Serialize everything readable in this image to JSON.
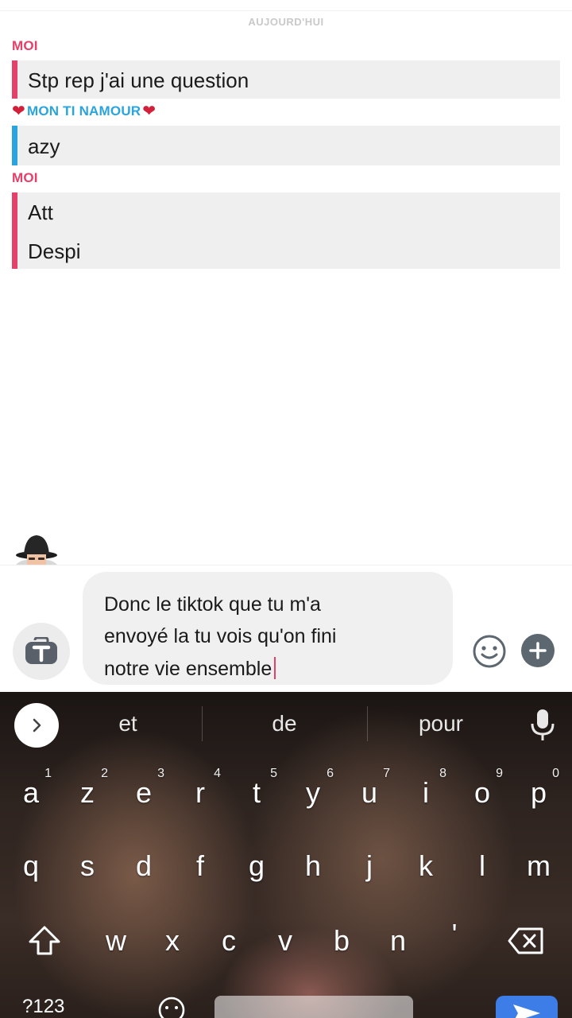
{
  "chat": {
    "date_label": "AUJOURD'HUI",
    "messages": [
      {
        "sender": "MOI",
        "side": "me",
        "lines": [
          "Stp rep j'ai une question"
        ]
      },
      {
        "sender": "MON TI NAMOUR",
        "side": "them",
        "lines": [
          "azy"
        ]
      },
      {
        "sender": "MOI",
        "side": "me",
        "lines": [
          "Att",
          "Despi"
        ]
      }
    ],
    "heart_glyph": "❤"
  },
  "composer": {
    "draft_lines": [
      "Donc le tiktok que tu m'a",
      "envoyé la tu vois qu'on fini",
      "notre vie ensemble"
    ]
  },
  "keyboard": {
    "suggestions": [
      "et",
      "de",
      "pour"
    ],
    "row1": [
      {
        "k": "a",
        "n": "1"
      },
      {
        "k": "z",
        "n": "2"
      },
      {
        "k": "e",
        "n": "3"
      },
      {
        "k": "r",
        "n": "4"
      },
      {
        "k": "t",
        "n": "5"
      },
      {
        "k": "y",
        "n": "6"
      },
      {
        "k": "u",
        "n": "7"
      },
      {
        "k": "i",
        "n": "8"
      },
      {
        "k": "o",
        "n": "9"
      },
      {
        "k": "p",
        "n": "0"
      }
    ],
    "row2": [
      "q",
      "s",
      "d",
      "f",
      "g",
      "h",
      "j",
      "k",
      "l",
      "m"
    ],
    "row3": [
      "w",
      "x",
      "c",
      "v",
      "b",
      "n",
      "'"
    ],
    "symbols_key": "?123"
  },
  "colors": {
    "me_accent": "#e4406a",
    "them_accent": "#2aa4de",
    "bubble_bg": "#efefef",
    "send_button": "#3c7de8"
  }
}
